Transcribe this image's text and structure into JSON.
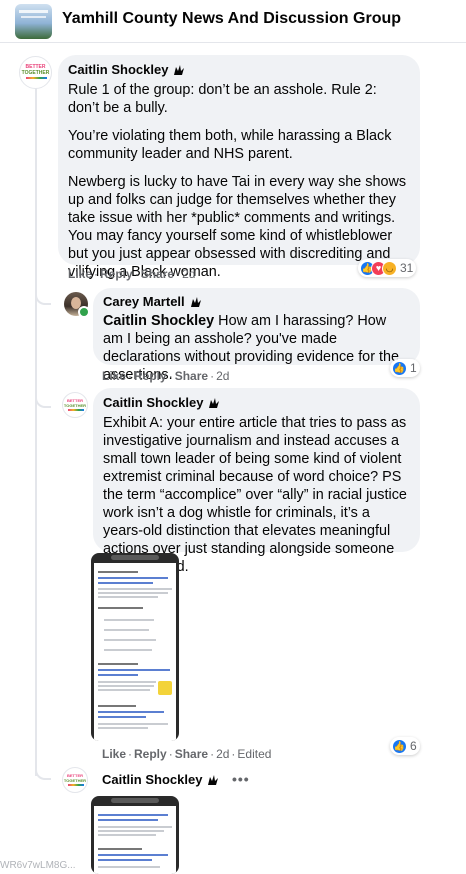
{
  "header": {
    "group_title": "Yamhill County News And Discussion Group"
  },
  "comments": [
    {
      "author": "Caitlin Shockley",
      "paragraphs": [
        "Rule 1 of the group: don’t be an asshole. Rule 2: don’t be a bully.",
        "You’re violating them both, while harassing a Black community leader and NHS parent.",
        "Newberg is lucky to have Tai in every way she shows up and folks can judge for themselves whether they take issue with her *public* comments and writings. You may fancy yourself some kind of whistleblower but you just appear obsessed with discrediting and vilifying a Black woman."
      ],
      "like_label": "Like",
      "reply_label": "Reply",
      "share_label": "Share",
      "timestamp": "2d",
      "reaction_count": "31",
      "reaction_icons": [
        "like-icon",
        "love-icon",
        "haha-icon"
      ]
    },
    {
      "author": "Carey Martell",
      "mention": "Caitlin Shockley",
      "text": "How am I harassing? How am I being an asshole? you've made declarations without providing evidence for the assertions.",
      "like_label": "Like",
      "reply_label": "Reply",
      "share_label": "Share",
      "timestamp": "2d",
      "reaction_count": "1"
    },
    {
      "author": "Caitlin Shockley",
      "text": "Exhibit A: your entire article that tries to pass as investigative journalism and instead accuses a small town leader of being some kind of violent extremist criminal because of word choice? PS the term “accomplice” over “ally” in racial justice work isn’t a dog whistle for criminals, it’s a years-old distinction that elevates meaningful actions over just standing alongside someone marginalized.",
      "like_label": "Like",
      "reply_label": "Reply",
      "share_label": "Share",
      "timestamp": "2d",
      "edited_label": "Edited",
      "reaction_count": "6"
    },
    {
      "author": "Caitlin Shockley",
      "more_label": "•••"
    }
  ],
  "avatar_text": {
    "line1": "BETTER",
    "line2": "TOGETHER"
  },
  "watermark": "WR6v7wLM8G..."
}
